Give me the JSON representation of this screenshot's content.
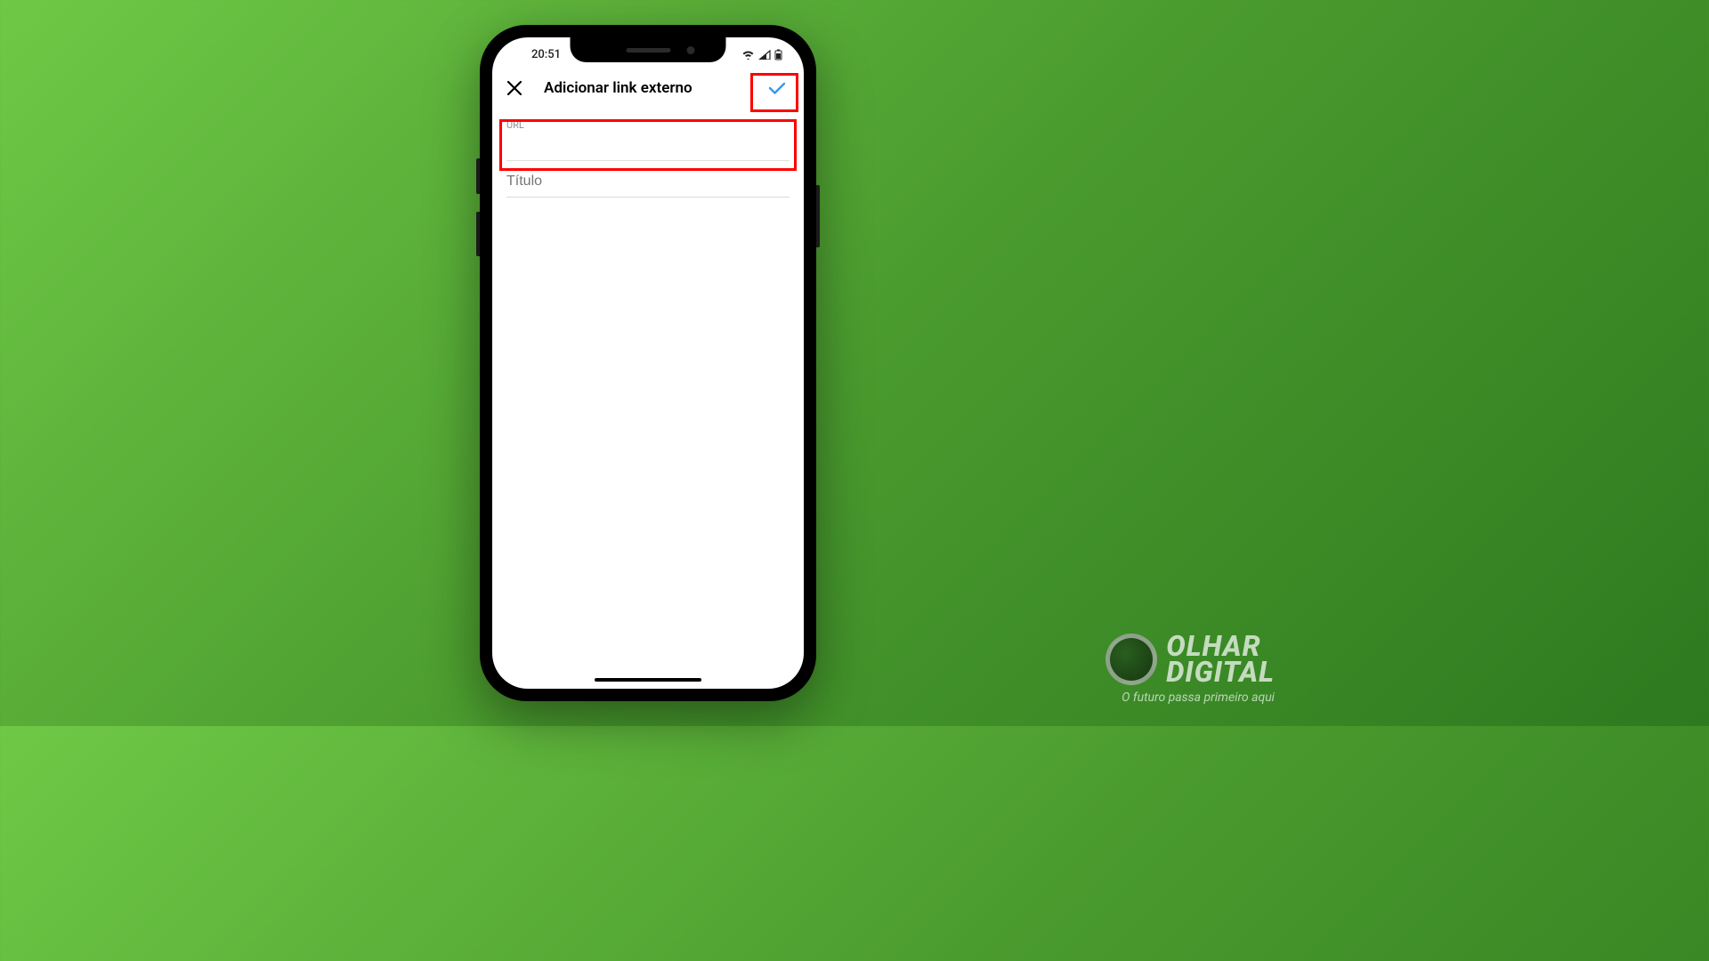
{
  "status": {
    "time": "20:51"
  },
  "header": {
    "title": "Adicionar link externo"
  },
  "form": {
    "url": {
      "label": "URL",
      "value": ""
    },
    "title": {
      "placeholder": "Título",
      "value": ""
    }
  },
  "brand": {
    "line1": "OLHAR",
    "line2": "DIGITAL",
    "tagline": "O futuro passa primeiro aqui"
  }
}
